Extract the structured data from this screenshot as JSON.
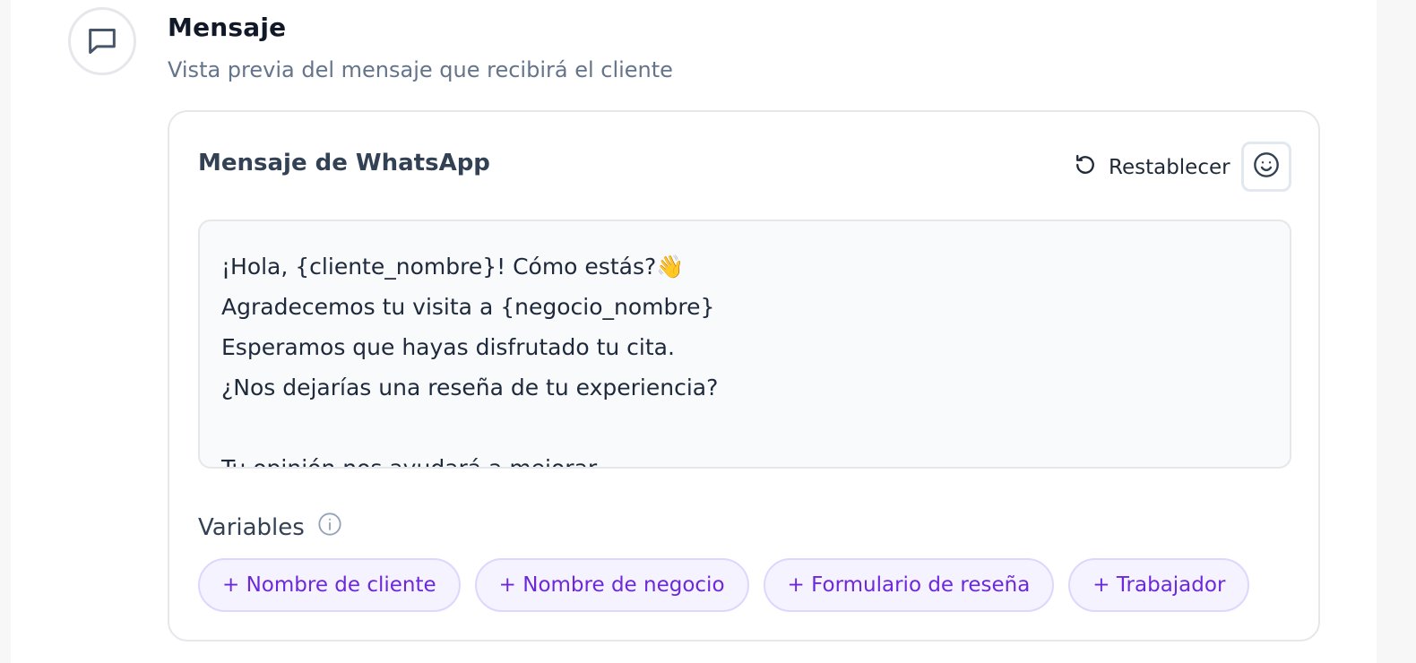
{
  "section": {
    "title": "Mensaje",
    "subtitle": "Vista previa del mensaje que recibirá el cliente"
  },
  "card": {
    "title": "Mensaje de WhatsApp",
    "reset_label": "Restablecer",
    "message_lines": [
      "¡Hola, {cliente_nombre}! Cómo estás?👋",
      "Agradecemos tu visita a {negocio_nombre}",
      "Esperamos que hayas disfrutado tu cita.",
      "¿Nos dejarías una reseña de tu experiencia?",
      "",
      "Tu opinión nos ayudará a mejorar."
    ],
    "variables_label": "Variables",
    "variable_chips": [
      "+ Nombre de cliente",
      "+ Nombre de negocio",
      "+ Formulario de reseña",
      "+ Trabajador"
    ]
  },
  "icons": {
    "section": "chat-bubble-icon",
    "reset": "rotate-ccw-icon",
    "emoji": "smiley-icon",
    "info": "info-icon"
  },
  "colors": {
    "accent": "#6d28d9",
    "chip_bg": "#f5f3ff",
    "chip_border": "#ddd6fe"
  }
}
